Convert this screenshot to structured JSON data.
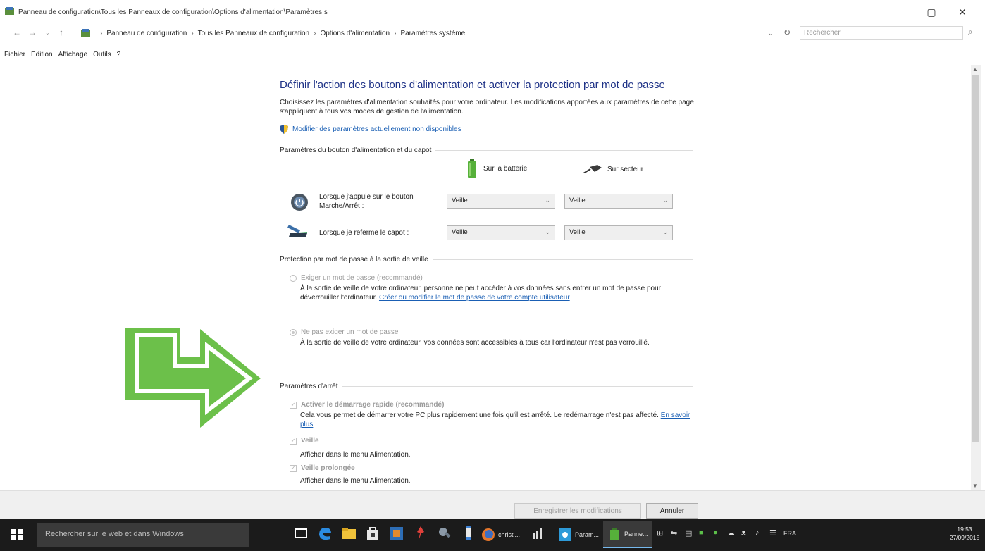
{
  "window": {
    "title": "Panneau de configuration\\Tous les Panneaux de configuration\\Options d'alimentation\\Paramètres s",
    "controls": {
      "minimize": "–",
      "maximize": "▢",
      "close": "✕"
    }
  },
  "address": {
    "crumbs": [
      "Panneau de configuration",
      "Tous les Panneaux de configuration",
      "Options d'alimentation",
      "Paramètres système"
    ],
    "search_placeholder": "Rechercher"
  },
  "menu": [
    "Fichier",
    "Edition",
    "Affichage",
    "Outils",
    "?"
  ],
  "page": {
    "heading": "Définir l'action des boutons d'alimentation et activer la protection par mot de passe",
    "description": "Choisissez les paramètres d'alimentation souhaités pour votre ordinateur. Les modifications apportées aux paramètres de cette page s'appliquent à tous vos modes de gestion de l'alimentation.",
    "unavailable_link": "Modifier des paramètres actuellement non disponibles"
  },
  "power_section": {
    "title": "Paramètres du bouton d'alimentation et du capot",
    "col_battery": "Sur la batterie",
    "col_ac": "Sur secteur",
    "rows": [
      {
        "label": "Lorsque j'appuie sur le bouton Marche/Arrêt :",
        "battery": "Veille",
        "ac": "Veille"
      },
      {
        "label": "Lorsque je referme le capot :",
        "battery": "Veille",
        "ac": "Veille"
      }
    ]
  },
  "password_section": {
    "title": "Protection par mot de passe à la sortie de veille",
    "opt1_label": "Exiger un mot de passe (recommandé)",
    "opt1_desc": "À la sortie de veille de votre ordinateur, personne ne peut accéder à vos données sans entrer un mot de passe pour déverrouiller l'ordinateur.",
    "opt1_link": "Créer ou modifier le mot de passe de votre compte utilisateur",
    "opt2_label": "Ne pas exiger un mot de passe",
    "opt2_desc": "À la sortie de veille de votre ordinateur, vos données sont accessibles à tous car l'ordinateur n'est pas verrouillé."
  },
  "shutdown_section": {
    "title": "Paramètres d'arrêt",
    "fast_label": "Activer le démarrage rapide (recommandé)",
    "fast_desc": "Cela vous permet de démarrer votre PC plus rapidement une fois qu'il est arrêté. Le redémarrage n'est pas affecté.",
    "fast_link": "En savoir plus",
    "sleep_label": "Veille",
    "sleep_desc": "Afficher dans le menu Alimentation.",
    "hibernate_label": "Veille prolongée",
    "hibernate_desc": "Afficher dans le menu Alimentation."
  },
  "buttons": {
    "save": "Enregistrer les modifications",
    "cancel": "Annuler"
  },
  "taskbar": {
    "search_placeholder": "Rechercher sur le web et dans Windows",
    "apps": [
      "christi...",
      "Param...",
      "Panne..."
    ],
    "lang": "FRA",
    "time": "19:53",
    "date": "27/09/2015"
  },
  "colors": {
    "heading": "#1e3287",
    "link": "#1a5fb4",
    "arrow": "#6cc04a",
    "taskbar": "#1b1b1b"
  }
}
